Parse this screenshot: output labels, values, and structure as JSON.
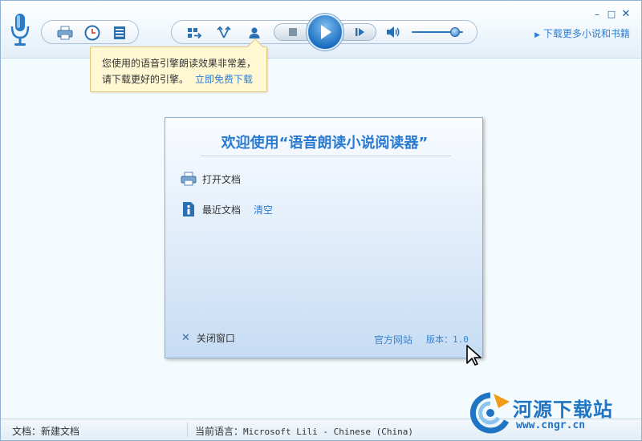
{
  "toolbar": {
    "more_link": "下载更多小说和书籍"
  },
  "tooltip": {
    "line1": "您使用的语音引擎朗读效果非常差，",
    "line2": "请下载更好的引擎。",
    "link": "立即免费下载"
  },
  "panel": {
    "title": "欢迎使用“语音朗读小说阅读器”",
    "open_doc": "打开文档",
    "recent_doc": "最近文档",
    "clear": "清空",
    "close": "关闭窗口",
    "site": "官方网站",
    "version": "版本：1.0"
  },
  "status": {
    "doc_label": "文档：",
    "doc_value": "新建文档",
    "lang_label": "当前语言：",
    "lang_value": "Microsoft Lili - Chinese (China)"
  },
  "watermark": {
    "name": "河源下载站",
    "url": "www.cngr.cn"
  },
  "volume": {
    "level": 0.85
  },
  "colors": {
    "accent": "#2e7dd1",
    "tooltip_bg": "#fff8d3"
  }
}
